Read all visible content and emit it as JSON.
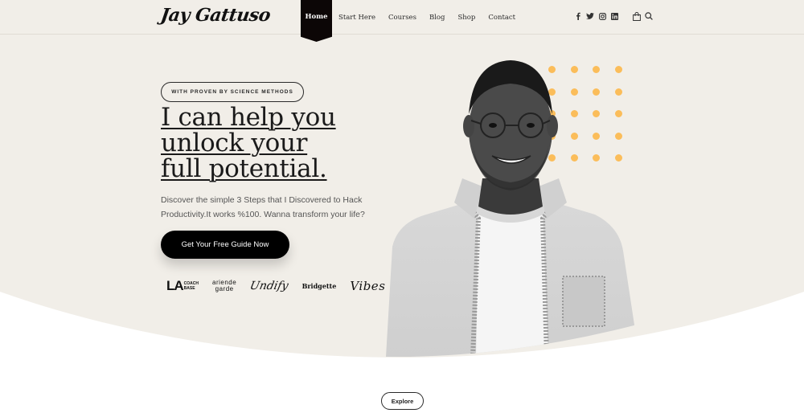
{
  "header": {
    "logo": "Jay Gattuso",
    "nav": [
      {
        "label": "Home",
        "active": true
      },
      {
        "label": "Start Here"
      },
      {
        "label": "Courses"
      },
      {
        "label": "Blog"
      },
      {
        "label": "Shop"
      },
      {
        "label": "Contact"
      }
    ],
    "icons": [
      "facebook-icon",
      "twitter-icon",
      "instagram-icon",
      "linkedin-icon",
      "shopping-bag-icon",
      "search-icon"
    ]
  },
  "hero": {
    "badge": "WITH PROVEN BY SCIENCE METHODS",
    "headline": [
      "I can help you",
      "unlock your",
      "full potential."
    ],
    "subtext": "Discover the simple 3 Steps that I Discovered to Hack Productivity.It works %100. Wanna transform your life?",
    "cta": "Get Your Free Guide Now",
    "brands": {
      "la_big": "LA",
      "la_small_1": "COACH",
      "la_small_2": "BASE",
      "ariende_1": "ariende",
      "ariende_2": "garde",
      "undify": "Undify",
      "bridgette": "Bridgette",
      "vibes": "Vibes"
    },
    "accent_color": "#fbbd5a",
    "background_color": "#f1eee8"
  },
  "footer": {
    "explore": "Explore"
  }
}
